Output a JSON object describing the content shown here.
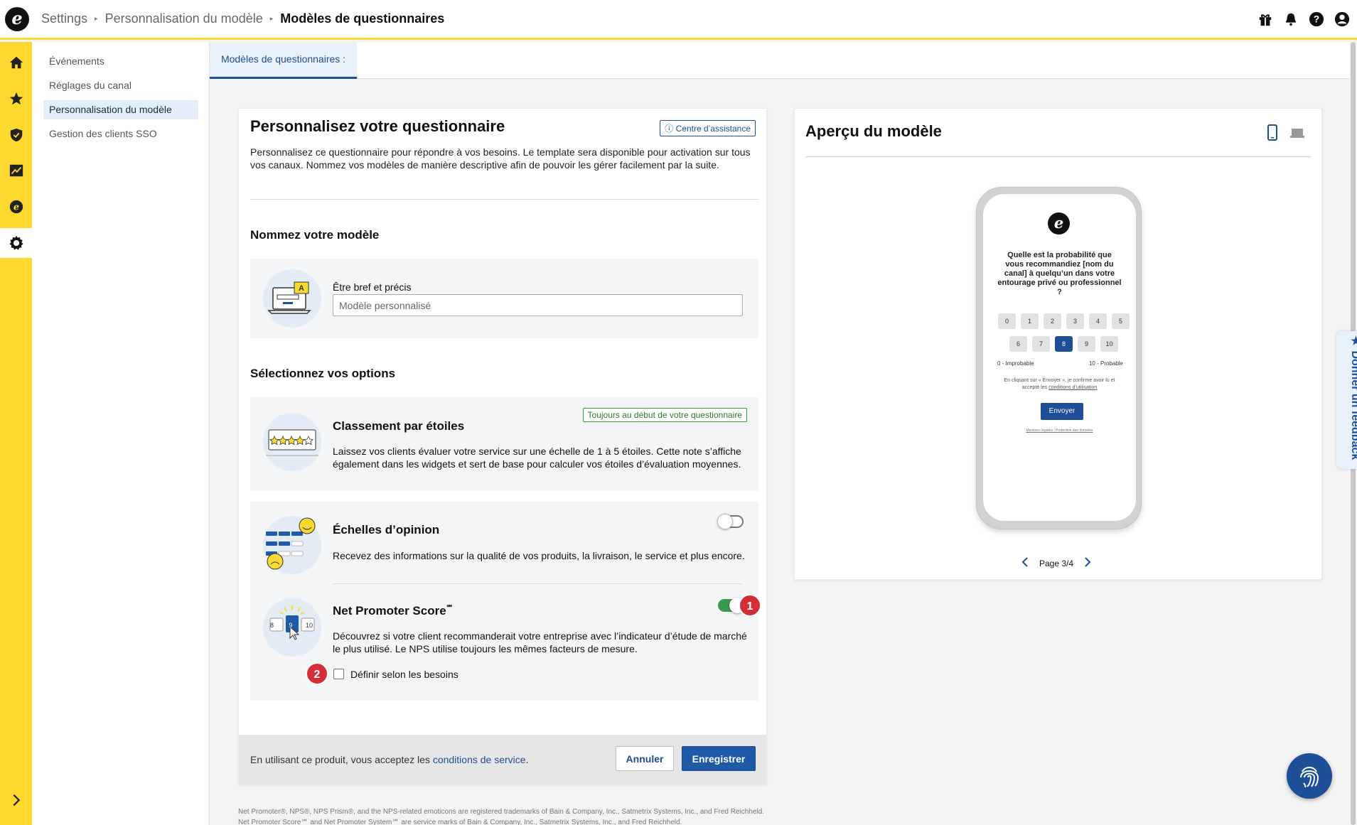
{
  "colors": {
    "accent": "#1e4e96",
    "rail": "#fcd92f",
    "toggle_on": "#3d9a4c",
    "badge": "#d42e36",
    "primary_button": "#1e5aa8"
  },
  "header": {
    "logo_letter": "e",
    "breadcrumb": [
      "Settings",
      "Personnalisation du modèle",
      "Modèles de questionnaires"
    ],
    "icons": [
      "gift-icon",
      "bell-icon",
      "help-icon",
      "account-icon"
    ]
  },
  "rail": {
    "icons": [
      "home-icon",
      "star-icon",
      "shield-icon",
      "chart-icon",
      "e-coin-icon",
      "gear-icon"
    ],
    "active": "gear-icon",
    "expand_icon": "chevron-right-icon"
  },
  "subnav": {
    "items": [
      {
        "label": "Événements"
      },
      {
        "label": "Réglages du canal"
      },
      {
        "label": "Personnalisation du modèle",
        "active": true
      },
      {
        "label": "Gestion des clients SSO"
      }
    ]
  },
  "tabs": [
    {
      "label": "Modèles de questionnaires :",
      "active": true
    }
  ],
  "form": {
    "title": "Personnalisez votre questionnaire",
    "help_label": "Centre d’assistance",
    "intro": "Personnalisez ce questionnaire pour répondre à vos besoins. Le template sera disponible pour activation sur tous vos canaux. Nommez vos modèles de manière descriptive afin de pouvoir les gérer facilement par la suite.",
    "name_section": {
      "heading": "Nommez votre modèle",
      "field_label": "Être bref et précis",
      "placeholder": "Modèle personnalisé",
      "value": ""
    },
    "options_heading": "Sélectionnez vos options",
    "options": {
      "stars": {
        "title": "Classement par étoiles",
        "badge": "Toujours au début de votre questionnaire",
        "description": "Laissez vos clients évaluer votre service sur une échelle de 1 à 5 étoiles. Cette note s’affiche également dans les widgets et sert de base pour calculer vos étoiles d’évaluation moyennes."
      },
      "opinion": {
        "title": "Échelles d’opinion",
        "description": "Recevez des informations sur la qualité de vos produits, la livraison, le service et plus encore.",
        "enabled": false
      },
      "nps": {
        "title": "Net Promoter Score",
        "trademark": "℠",
        "description": "Découvrez si votre client recommanderait votre entreprise avec l’indicateur d’étude de marché le plus utilisé. Le NPS utilise toujours les mêmes facteurs de mesure.",
        "enabled": true,
        "illus_numbers": [
          "8",
          "9",
          "10"
        ],
        "custom_checkbox_label": "Définir selon les besoins",
        "custom_checked": false
      }
    },
    "callouts": [
      "1",
      "2"
    ],
    "footer": {
      "text_before": "En utilisant ce produit, vous acceptez les ",
      "link": "conditions de service",
      "text_after": ".",
      "cancel_label": "Annuler",
      "save_label": "Enregistrer"
    },
    "legal": "Net Promoter®, NPS®, NPS Prism®, and the NPS-related emoticons are registered trademarks of Bain & Company, Inc., Satmetrix Systems, Inc., and Fred Reichheld. Net Promoter Score℠ and Net Promoter System℠ are service marks of Bain & Company, Inc., Satmetrix Systems, Inc., and Fred Reichheld."
  },
  "preview": {
    "title": "Aperçu du modèle",
    "device_selected": "mobile",
    "logo_letter": "e",
    "question": "Quelle est la probabilité que vous recommandiez [nom du canal] à quelqu’un dans votre entourage privé ou professionnel ?",
    "scores_row1": [
      "0",
      "1",
      "2",
      "3",
      "4",
      "5"
    ],
    "scores_row2": [
      "6",
      "7",
      "8",
      "9",
      "10"
    ],
    "selected_score": "8",
    "low_label": "0 - Improbable",
    "high_label": "10 - Probable",
    "consent_text": "En cliquant sur « Envoyer », je confirme avoir lu et accepté les ",
    "consent_link": "conditions d’utilisation",
    "send_label": "Envoyer",
    "footer_links": "Mentions légales | Protection des données",
    "page_label": "Page 3/4"
  },
  "feedback_tab": "Donner un feedback"
}
